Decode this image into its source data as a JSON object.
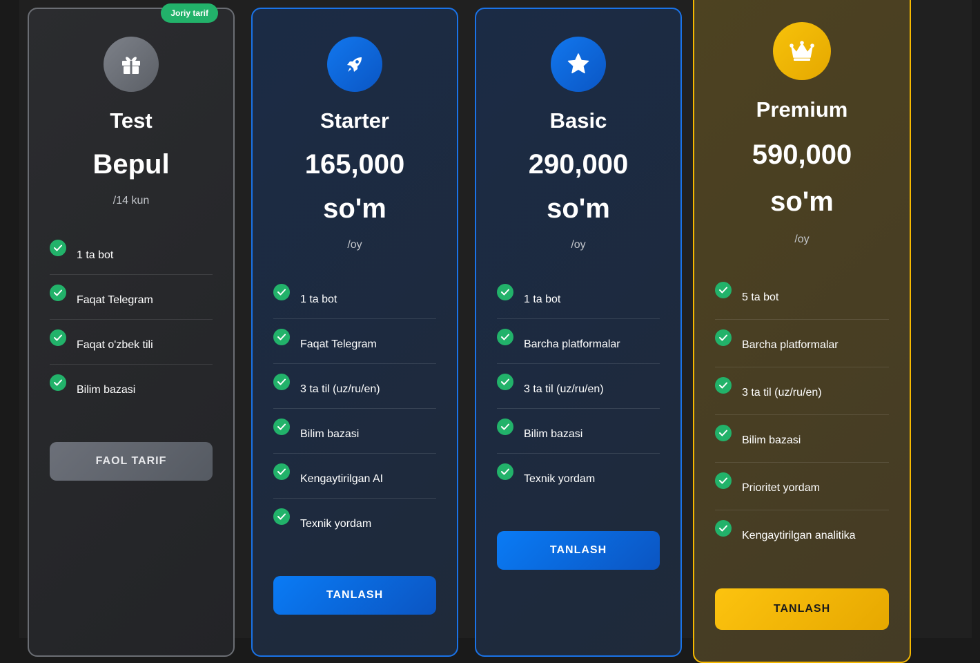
{
  "plans": [
    {
      "name": "Test",
      "price": "Bepul",
      "period": "/14 kun",
      "badge": "Joriy tarif",
      "icon": "gift-icon",
      "features": [
        "1 ta bot",
        "Faqat Telegram",
        "Faqat o'zbek tili",
        "Bilim bazasi"
      ],
      "button_label": "FAOL TARIF"
    },
    {
      "name": "Starter",
      "price_amount": "165,000",
      "price_currency": "so'm",
      "period": "/oy",
      "icon": "rocket-icon",
      "features": [
        "1 ta bot",
        "Faqat Telegram",
        "3 ta til (uz/ru/en)",
        "Bilim bazasi",
        "Kengaytirilgan AI",
        "Texnik yordam"
      ],
      "button_label": "TANLASH"
    },
    {
      "name": "Basic",
      "price_amount": "290,000",
      "price_currency": "so'm",
      "period": "/oy",
      "icon": "star-icon",
      "features": [
        "1 ta bot",
        "Barcha platformalar",
        "3 ta til (uz/ru/en)",
        "Bilim bazasi",
        "Texnik yordam"
      ],
      "button_label": "TANLASH"
    },
    {
      "name": "Premium",
      "price_amount": "590,000",
      "price_currency": "so'm",
      "period": "/oy",
      "icon": "crown-icon",
      "features": [
        "5 ta bot",
        "Barcha platformalar",
        "3 ta til (uz/ru/en)",
        "Bilim bazasi",
        "Prioritet yordam",
        "Kengaytirilgan analitika"
      ],
      "button_label": "TANLASH"
    }
  ],
  "colors": {
    "accent_blue": "#1a73e8",
    "accent_gold": "#f5b800",
    "success_green": "#22b26a"
  }
}
